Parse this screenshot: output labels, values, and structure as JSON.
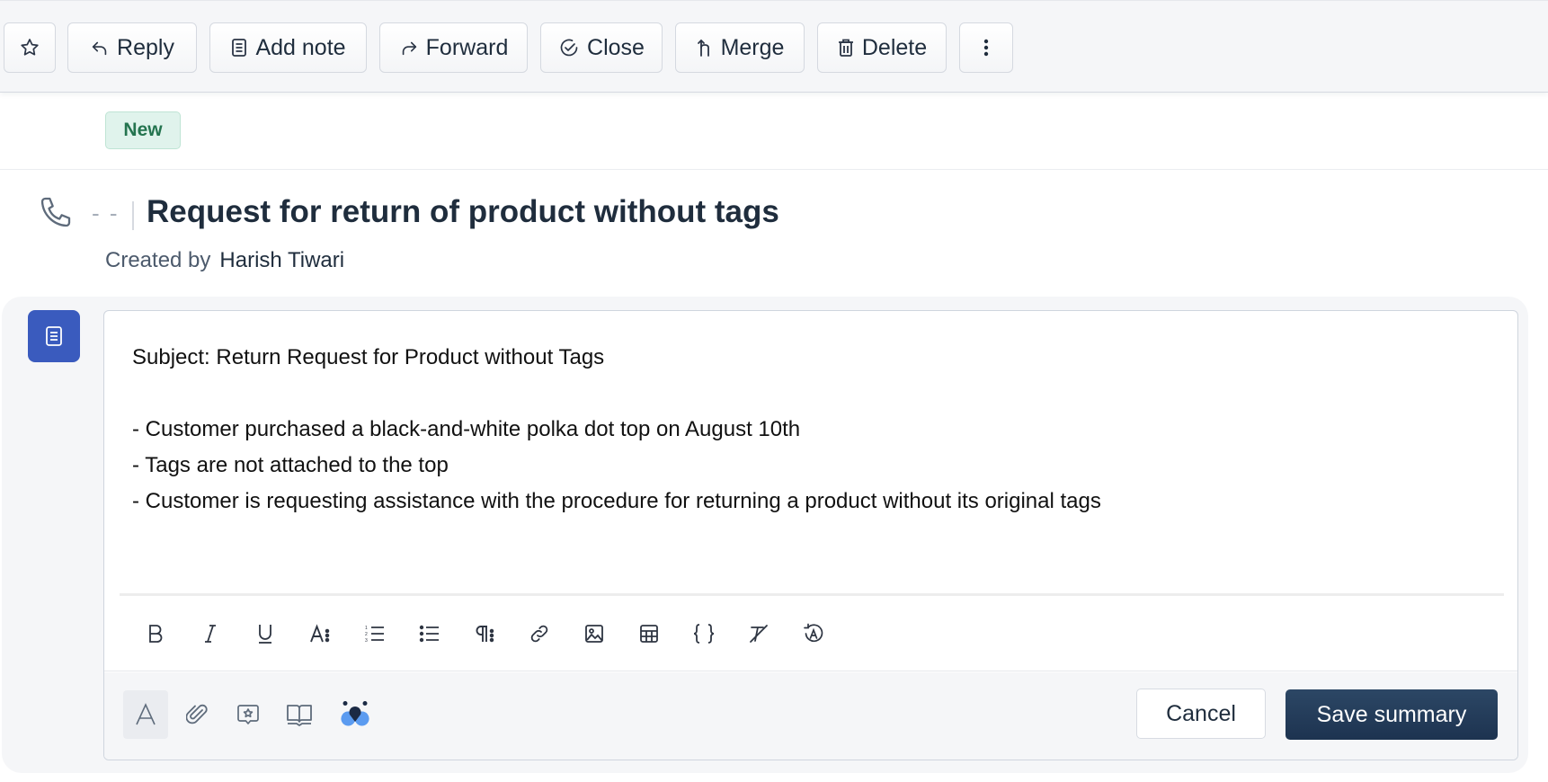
{
  "toolbar": {
    "star_label": "",
    "buttons": [
      {
        "id": "reply",
        "label": "Reply",
        "icon": "reply-arrow-icon"
      },
      {
        "id": "add-note",
        "label": "Add note",
        "icon": "note-icon"
      },
      {
        "id": "forward",
        "label": "Forward",
        "icon": "forward-arrow-icon"
      },
      {
        "id": "close",
        "label": "Close",
        "icon": "check-circle-icon"
      },
      {
        "id": "merge",
        "label": "Merge",
        "icon": "merge-icon"
      },
      {
        "id": "delete",
        "label": "Delete",
        "icon": "trash-icon"
      }
    ],
    "more_icon": "more-vertical-icon"
  },
  "ticket": {
    "status_badge": "New",
    "status_color": "#24744f",
    "channel_icon": "phone-icon",
    "id_placeholder": "- -",
    "title": "Request for return of product without tags",
    "created_by_label": "Created by",
    "created_by": "Harish Tiwari"
  },
  "summary_editor": {
    "icon": "document-icon",
    "accent_color": "#3a5bbe",
    "content": {
      "subject": "Subject: Return Request for Product without Tags",
      "bullets": [
        "- Customer purchased a black-and-white polka dot top on August 10th",
        "- Tags are not attached to the top",
        "- Customer is requesting assistance with the procedure for returning a product without its original tags"
      ]
    },
    "format_toolbar": [
      "bold",
      "italic",
      "underline",
      "font-size",
      "ordered-list",
      "unordered-list",
      "paragraph",
      "link",
      "image",
      "table",
      "code-braces",
      "clear-formatting",
      "undo-format"
    ],
    "footer_tools": [
      "text-format",
      "attachment",
      "canned-response",
      "knowledge-base",
      "ai-assist"
    ],
    "cancel_label": "Cancel",
    "save_label": "Save summary",
    "save_color": "#1d3350"
  }
}
